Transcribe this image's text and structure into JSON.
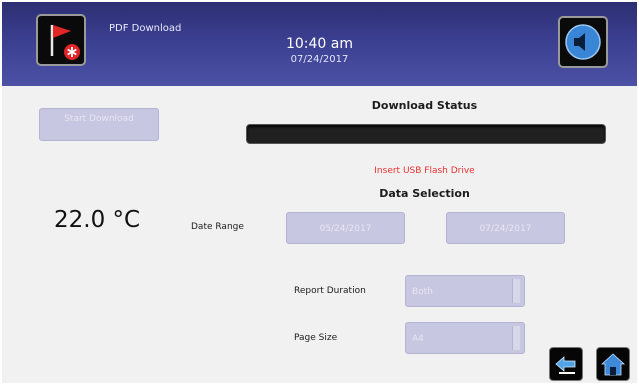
{
  "header": {
    "title": "PDF Download",
    "time": "10:40 am",
    "date": "07/24/2017",
    "alarm_icon": "flag-alarm-icon",
    "sound_icon": "speaker-icon"
  },
  "download": {
    "start_label": "Start Download",
    "status_heading": "Download Status",
    "progress": 0,
    "message": "Insert USB Flash Drive"
  },
  "temperature": "22.0 °C",
  "data_selection": {
    "heading": "Data Selection",
    "date_range_label": "Date Range",
    "start_date": "05/24/2017",
    "end_date": "07/24/2017",
    "report_duration_label": "Report Duration",
    "report_duration_value": "Both",
    "page_size_label": "Page Size",
    "page_size_value": "A4"
  },
  "footer": {
    "back_icon": "back-arrow-icon",
    "home_icon": "home-icon"
  },
  "colors": {
    "header": "#3b3f90",
    "accent_red": "#e83030",
    "disabled_control": "#c7c7e1",
    "background": "#f1f1f2"
  }
}
